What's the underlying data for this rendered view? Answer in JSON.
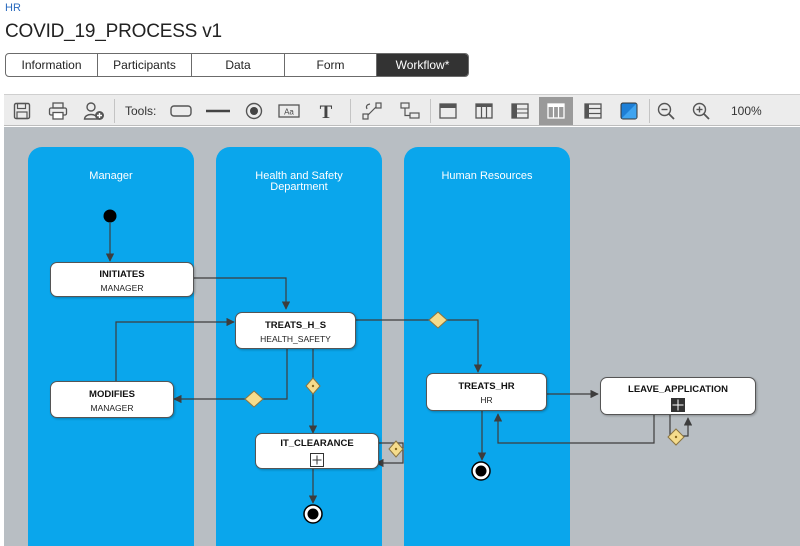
{
  "breadcrumb": "HR",
  "title": "COVID_19_PROCESS v1",
  "tabs": [
    "Information",
    "Participants",
    "Data",
    "Form",
    "Workflow*"
  ],
  "active_tab": "Workflow*",
  "toolbar": {
    "tools_label": "Tools:",
    "zoom": "100%",
    "icons": [
      "save-icon",
      "print-icon",
      "add-participant-icon",
      "rounded-rectangle-tool-icon",
      "line-tool-icon",
      "circle-tool-icon",
      "text-box-tool-icon",
      "text-tool-icon",
      "connector-icon",
      "hierarchy-icon",
      "top-band-icon",
      "column-layout-icon",
      "left-panel-icon",
      "swimlanes-icon",
      "rows-icon",
      "color-fill-icon",
      "zoom-out-icon",
      "zoom-in-icon"
    ],
    "selected": "swimlanes-icon"
  },
  "colors": {
    "lane": "#0aa6ec",
    "canvas": "#b8bec3",
    "gateway": "#f5dc8c",
    "active_tab": "#333333"
  },
  "lanes": [
    "Manager",
    "Health and Safety Department",
    "Human Resources"
  ],
  "nodes": {
    "initiates": {
      "title": "INITIATES",
      "sub": "MANAGER"
    },
    "modifies": {
      "title": "MODIFIES",
      "sub": "MANAGER"
    },
    "treats_h_s": {
      "title": "TREATS_H_S",
      "sub": "HEALTH_SAFETY"
    },
    "it_clearance": {
      "title": "IT_CLEARANCE"
    },
    "treats_hr": {
      "title": "TREATS_HR",
      "sub": "HR"
    },
    "leave_application": {
      "title": "LEAVE_APPLICATION"
    }
  }
}
